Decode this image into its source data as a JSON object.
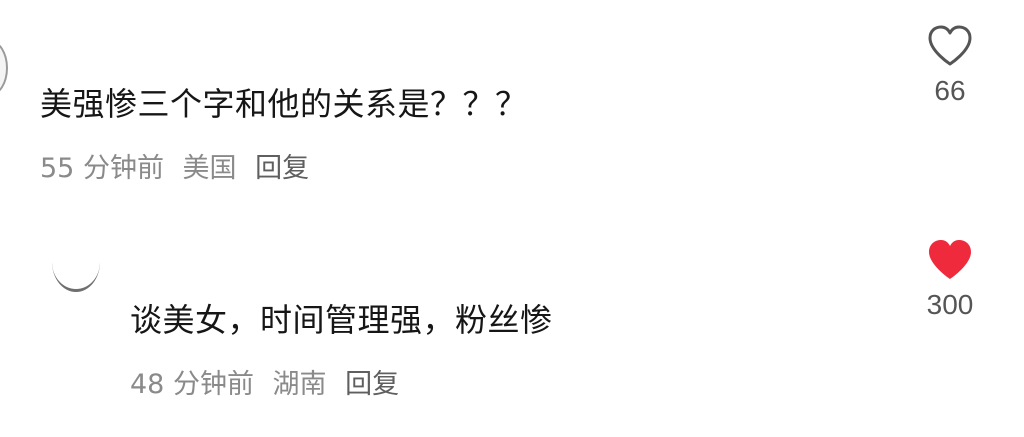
{
  "comments": [
    {
      "text": "美强惨三个字和他的关系是？？？",
      "time": "55 分钟前",
      "location": "美国",
      "reply_label": "回复",
      "like_count": "66",
      "liked": false
    },
    {
      "text": "谈美女，时间管理强，粉丝惨",
      "time": "48 分钟前",
      "location": "湖南",
      "reply_label": "回复",
      "like_count": "300",
      "liked": true
    }
  ],
  "colors": {
    "liked_heart": "#ee2a3c",
    "unliked_heart": "#555555",
    "meta_text": "#8a8a8a"
  },
  "icons": {
    "like_outline": "heart-outline-icon",
    "like_filled": "heart-filled-icon"
  }
}
